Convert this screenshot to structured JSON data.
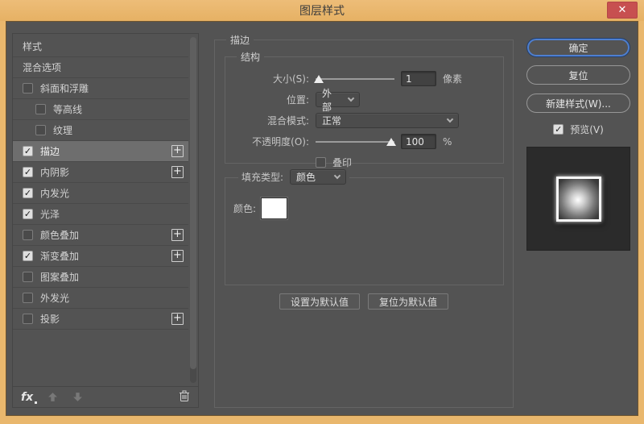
{
  "window": {
    "title": "图层样式"
  },
  "icons": {
    "close": "✕",
    "check": "✓",
    "plus": "+",
    "fx": "fx"
  },
  "colors": {
    "titlebar": "#e9b76d",
    "close_red": "#c75050",
    "panel_bg": "#535353",
    "focus_blue": "#4e7fd0",
    "stroke_color_swatch": "#ffffff"
  },
  "sidebar": {
    "items": [
      {
        "id": "styles",
        "label": "样式",
        "type": "plain"
      },
      {
        "id": "blending-options",
        "label": "混合选项",
        "type": "plain"
      },
      {
        "id": "bevel-emboss",
        "label": "斜面和浮雕",
        "checkbox": true,
        "checked": false
      },
      {
        "id": "contour",
        "label": "等高线",
        "checkbox": true,
        "checked": false,
        "indent": true
      },
      {
        "id": "texture",
        "label": "纹理",
        "checkbox": true,
        "checked": false,
        "indent": true
      },
      {
        "id": "stroke",
        "label": "描边",
        "checkbox": true,
        "checked": true,
        "selected": true,
        "plus": true
      },
      {
        "id": "inner-shadow",
        "label": "内阴影",
        "checkbox": true,
        "checked": true,
        "plus": true
      },
      {
        "id": "inner-glow",
        "label": "内发光",
        "checkbox": true,
        "checked": true
      },
      {
        "id": "satin",
        "label": "光泽",
        "checkbox": true,
        "checked": true
      },
      {
        "id": "color-overlay",
        "label": "颜色叠加",
        "checkbox": true,
        "checked": false,
        "plus": true
      },
      {
        "id": "gradient-overlay",
        "label": "渐变叠加",
        "checkbox": true,
        "checked": true,
        "plus": true
      },
      {
        "id": "pattern-overlay",
        "label": "图案叠加",
        "checkbox": true,
        "checked": false
      },
      {
        "id": "outer-glow",
        "label": "外发光",
        "checkbox": true,
        "checked": false
      },
      {
        "id": "drop-shadow",
        "label": "投影",
        "checkbox": true,
        "checked": false,
        "plus": true
      }
    ]
  },
  "panel": {
    "title": "描边",
    "structure": {
      "group_title": "结构",
      "size_label": "大小(S):",
      "size_value": "1",
      "size_unit": "像素",
      "position_label": "位置:",
      "position_value": "外部",
      "blend_label": "混合模式:",
      "blend_value": "正常",
      "opacity_label": "不透明度(O):",
      "opacity_value": "100",
      "opacity_unit": "%",
      "overprint_label": "叠印"
    },
    "fill": {
      "type_label": "填充类型:",
      "type_value": "颜色",
      "color_label": "颜色:"
    },
    "buttons": {
      "make_default": "设置为默认值",
      "reset_default": "复位为默认值"
    }
  },
  "actions": {
    "ok": "确定",
    "reset": "复位",
    "new_style": "新建样式(W)...",
    "preview": "预览(V)"
  }
}
